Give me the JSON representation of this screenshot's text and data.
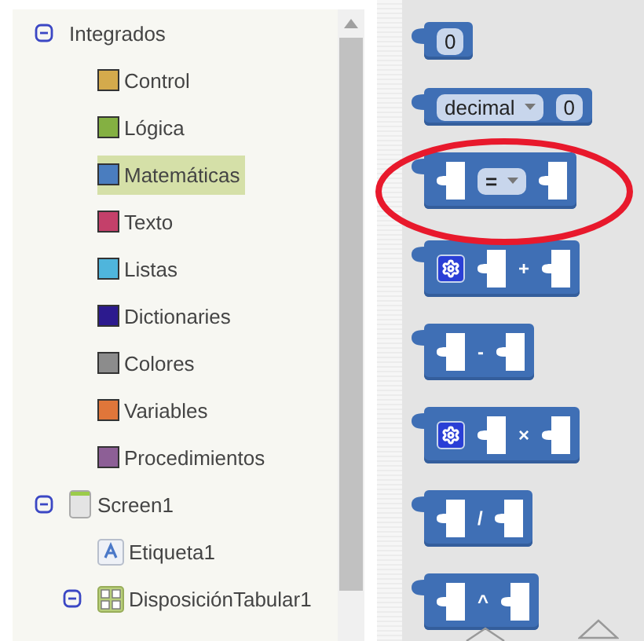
{
  "tree": [
    {
      "label": "Integrados",
      "kind": "group",
      "expanded": true,
      "children": [
        {
          "label": "Control",
          "kind": "category",
          "color": "#d4aa4c",
          "selected": false
        },
        {
          "label": "Lógica",
          "kind": "category",
          "color": "#84b042",
          "selected": false
        },
        {
          "label": "Matemáticas",
          "kind": "category",
          "color": "#4a7dbf",
          "selected": true
        },
        {
          "label": "Texto",
          "kind": "category",
          "color": "#c4406a",
          "selected": false
        },
        {
          "label": "Listas",
          "kind": "category",
          "color": "#4fb5dc",
          "selected": false
        },
        {
          "label": "Dictionaries",
          "kind": "category",
          "color": "#2c1a8e",
          "selected": false
        },
        {
          "label": "Colores",
          "kind": "category",
          "color": "#8c8c8c",
          "selected": false
        },
        {
          "label": "Variables",
          "kind": "category",
          "color": "#e0763a",
          "selected": false
        },
        {
          "label": "Procedimientos",
          "kind": "category",
          "color": "#8d5f96",
          "selected": false
        }
      ]
    },
    {
      "label": "Screen1",
      "kind": "screen",
      "expanded": true,
      "children": [
        {
          "label": "Etiqueta1",
          "kind": "label"
        },
        {
          "label": "DisposiciónTabular1",
          "kind": "table",
          "expanded": true
        }
      ]
    }
  ],
  "blocks": [
    {
      "kind": "number",
      "value": "0"
    },
    {
      "kind": "decimal",
      "option": "decimal",
      "value": "0"
    },
    {
      "kind": "compare",
      "operator": "=",
      "highlighted": true
    },
    {
      "kind": "arith",
      "operator": "+",
      "gear": true
    },
    {
      "kind": "arith",
      "operator": "-",
      "gear": false
    },
    {
      "kind": "arith",
      "operator": "×",
      "gear": true
    },
    {
      "kind": "arith",
      "operator": "/",
      "gear": false
    },
    {
      "kind": "arith",
      "operator": "^",
      "gear": false
    }
  ]
}
